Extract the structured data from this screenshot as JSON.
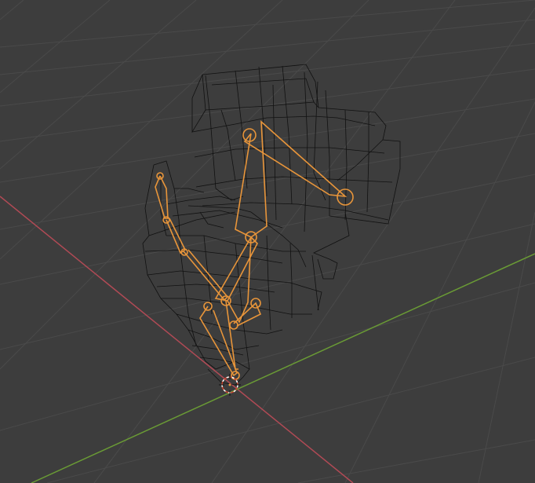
{
  "viewport": {
    "mode": "3d-viewport",
    "background": "#3d3d3d",
    "grid_color": "#4a4a4a",
    "x_axis_color": "#b14a55",
    "y_axis_color": "#6a9b35",
    "wire_color": "#111111",
    "bone_color": "#e8953a",
    "cursor_color": "#c8452f"
  },
  "icons": {
    "origin": "3d-cursor-icon"
  }
}
